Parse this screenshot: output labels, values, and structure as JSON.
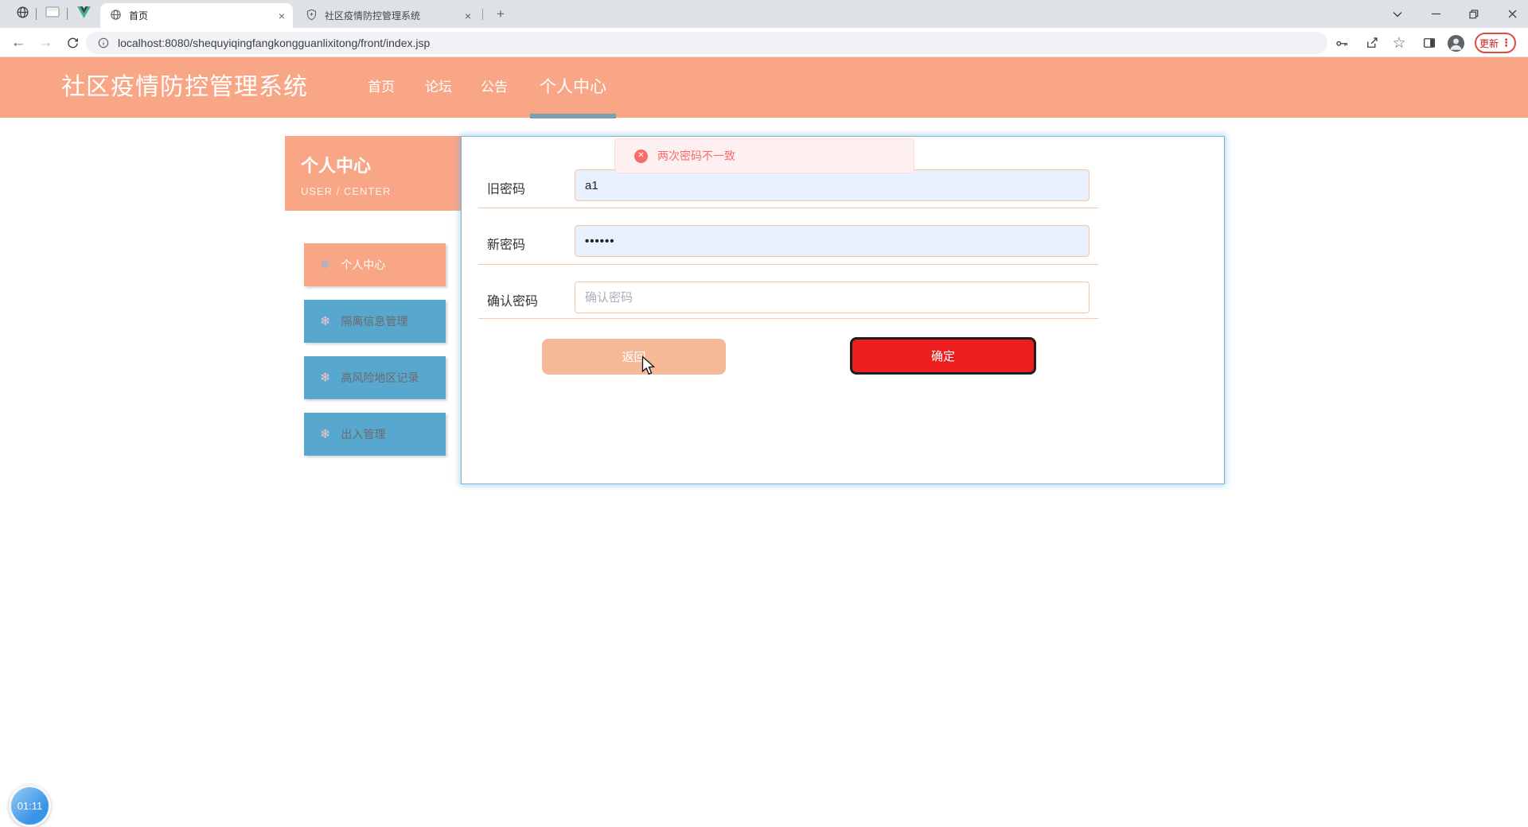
{
  "browser": {
    "tabs": [
      {
        "title": "首页"
      },
      {
        "title": "社区疫情防控管理系统"
      }
    ],
    "url": "localhost:8080/shequyiqingfangkongguanlixitong/front/index.jsp",
    "update_label": "更新",
    "close_glyph": "×",
    "new_tab_glyph": "+",
    "back_glyph": "←",
    "forward_glyph": "→",
    "star_glyph": "☆",
    "menu_dots": "⋮"
  },
  "header": {
    "title": "社区疫情防控管理系统",
    "nav": {
      "home": "首页",
      "forum": "论坛",
      "notice": "公告",
      "user_center": "个人中心"
    }
  },
  "sidebar": {
    "title": "个人中心",
    "subtitle": "USER / CENTER",
    "snowflake_glyph": "❄",
    "items": [
      {
        "label": "个人中心"
      },
      {
        "label": "隔离信息管理"
      },
      {
        "label": "高风险地区记录"
      },
      {
        "label": "出入管理"
      }
    ]
  },
  "toast": {
    "message": "两次密码不一致",
    "icon_glyph": "✕"
  },
  "form": {
    "old_password": {
      "label": "旧密码",
      "value": "a1"
    },
    "new_password": {
      "label": "新密码",
      "value": "••••••"
    },
    "confirm_password": {
      "label": "确认密码",
      "placeholder": "确认密码"
    },
    "back_label": "返回",
    "confirm_label": "确定"
  },
  "recorder": {
    "time": "01:11"
  },
  "colors": {
    "header_salmon": "#F9A687",
    "sidebar_blue": "#57A7CF",
    "error_red": "#F56C6C",
    "confirm_red": "#ED1E1F",
    "back_salmon": "#F6B998",
    "nav_underline": "#7C9FB1",
    "autofill_blue": "#E8F0FE"
  }
}
